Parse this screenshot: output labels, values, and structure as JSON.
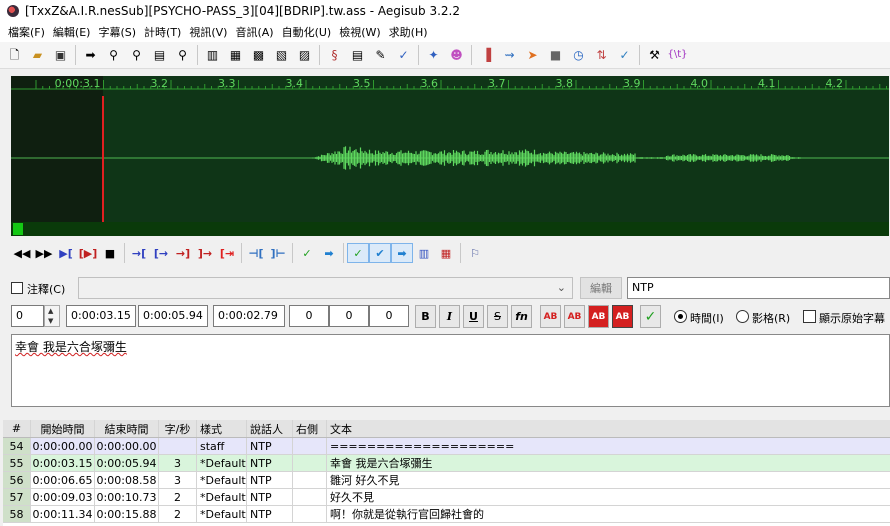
{
  "window": {
    "title": "[TxxZ&A.I.R.nesSub][PSYCHO-PASS_3][04][BDRIP].tw.ass - Aegisub 3.2.2"
  },
  "menu": [
    "檔案(F)",
    "編輯(E)",
    "字幕(S)",
    "計時(T)",
    "視訊(V)",
    "音訊(A)",
    "自動化(U)",
    "檢視(W)",
    "求助(H)"
  ],
  "audio": {
    "ruler_labels": [
      "0:00:3.1",
      "3.2",
      "3.3",
      "3.4",
      "3.5",
      "3.6",
      "3.7",
      "3.8",
      "3.9",
      "4.0",
      "4.1",
      "4.2"
    ],
    "colors": {
      "background": "#0f1f10",
      "selection": "#0f3517",
      "waveform": "#5fd85f",
      "cursor": "#e02020",
      "ruler": "#2f9a2f"
    }
  },
  "edit": {
    "comment_label": "注釋(C)",
    "edit_button": "編輯",
    "actor": "NTP",
    "layer": "0",
    "start_time": "0:00:03.15",
    "end_time": "0:00:05.94",
    "duration": "0:00:02.79",
    "margin_left": "0",
    "margin_right": "0",
    "margin_vertical": "0",
    "format_buttons": {
      "bold": "B",
      "italic": "I",
      "underline": "U",
      "strike": "S",
      "font": "fn",
      "ab": "AB"
    },
    "time_label": "時間(I)",
    "frame_label": "影格(R)",
    "show_original_label": "顯示原始字幕",
    "text": "幸會 我是六合塚彌生"
  },
  "grid": {
    "columns": [
      "#",
      "開始時間",
      "結束時間",
      "字/秒",
      "樣式",
      "說話人",
      "右側",
      "文本"
    ],
    "rows": [
      {
        "num": "54",
        "start": "0:00:00.00",
        "end": "0:00:00.00",
        "cps": "",
        "style": "staff",
        "actor": "NTP",
        "text": "===================="
      },
      {
        "num": "55",
        "start": "0:00:03.15",
        "end": "0:00:05.94",
        "cps": "3",
        "style": "*Default",
        "actor": "NTP",
        "text": "幸會 我是六合塚彌生"
      },
      {
        "num": "56",
        "start": "0:00:06.65",
        "end": "0:00:08.58",
        "cps": "3",
        "style": "*Default",
        "actor": "NTP",
        "text": "雛河 好久不見"
      },
      {
        "num": "57",
        "start": "0:00:09.03",
        "end": "0:00:10.73",
        "cps": "2",
        "style": "*Default",
        "actor": "NTP",
        "text": "好久不見"
      },
      {
        "num": "58",
        "start": "0:00:11.34",
        "end": "0:00:15.88",
        "cps": "2",
        "style": "*Default",
        "actor": "NTP",
        "text": "啊！你就是從執行官回歸社會的"
      }
    ],
    "row_colors": {
      "comment": "#e6e6fa",
      "selected": "#d9f5dc",
      "normal": "#ffffff"
    }
  }
}
